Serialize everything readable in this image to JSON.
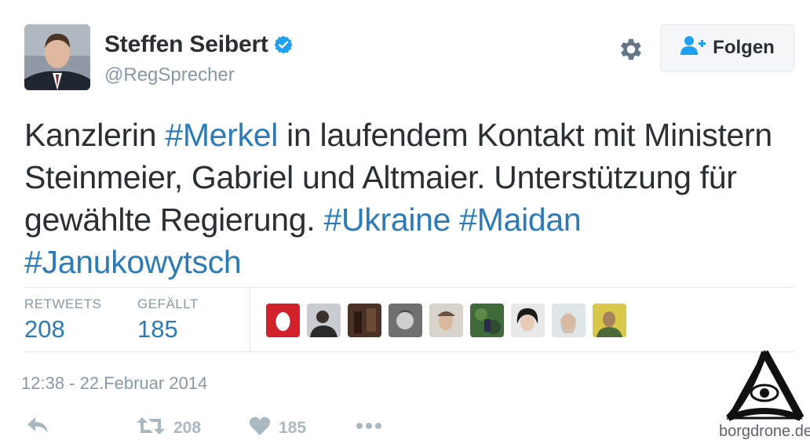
{
  "profile": {
    "name": "Steffen Seibert",
    "handle": "@RegSprecher",
    "verified_icon": "verified-badge-icon"
  },
  "follow_button": {
    "label": "Folgen",
    "icon": "add-person-icon"
  },
  "tweet": {
    "parts": [
      {
        "text": "Kanzlerin ",
        "hashtag": false
      },
      {
        "text": "#Merkel",
        "hashtag": true
      },
      {
        "text": " in laufendem Kontakt mit Ministern Steinmeier, Gabriel und Altmaier. Unterstützung für gewählte Regierung. ",
        "hashtag": false
      },
      {
        "text": "#Ukraine",
        "hashtag": true
      },
      {
        "text": " ",
        "hashtag": false
      },
      {
        "text": "#Maidan",
        "hashtag": true
      },
      {
        "text": " ",
        "hashtag": false
      },
      {
        "text": "#Janukowytsch",
        "hashtag": true
      }
    ]
  },
  "stats": {
    "retweets_label": "RETWEETS",
    "retweets_value": "208",
    "likes_label": "GEFÄLLT",
    "likes_value": "185"
  },
  "timestamp": "12:38 - 22.Februar 2014",
  "actions": {
    "reply_icon": "reply-icon",
    "retweet_count": "208",
    "like_count": "185",
    "more_icon": "more-icon"
  },
  "watermark": {
    "text": "borgdrone.de"
  },
  "colors": {
    "link": "#2b7bb9",
    "text": "#292f33",
    "muted": "#8899a6",
    "verified": "#1da1f2"
  }
}
